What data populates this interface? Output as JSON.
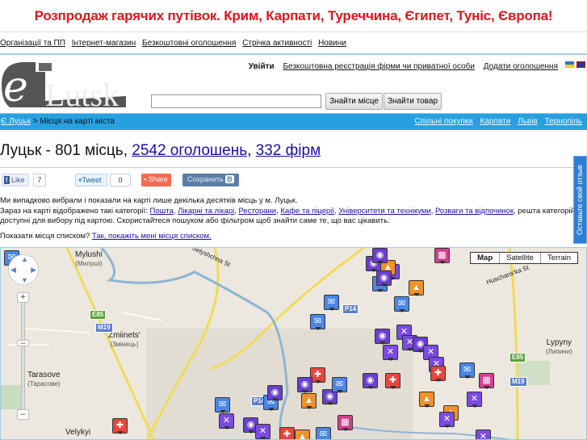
{
  "banner": "Розпродаж гарячих путівок. Крим, Карпати, Туреччина, Єгипет, Туніс, Європа!",
  "topnav": [
    "Організації та ПП",
    "Інтернет-магазин",
    "Безкоштовні оголошення",
    "Стрічка активності",
    "Новини"
  ],
  "logo": "eLutsk",
  "userlinks": {
    "login": "Увійти",
    "register": "Безкоштовна реєстрація фірми чи приватної особи",
    "add": "Додати оголошення"
  },
  "search": {
    "value": "",
    "find_place": "Знайти місце",
    "find_product": "Знайти товар"
  },
  "breadcrumb": {
    "home": "Є Луцьк",
    "sep": " > ",
    "current": "Місця на карті міста"
  },
  "cities": [
    "Спільні покупки",
    "Карпати",
    "Львів",
    "Тернопіль"
  ],
  "title": {
    "prefix": "Луцьк - 801 місць, ",
    "ads": "2542 оголошень",
    "comma": ", ",
    "firms": "332 фірм"
  },
  "social": {
    "like": "Like",
    "like_count": "7",
    "tweet": "Tweet",
    "tweet_count": "0",
    "share": "Share",
    "save": "Сохранить",
    "vk": "B"
  },
  "intro": {
    "line1": "Ми випадково вибрали і показали на карті лише декілька десятків місць у м. Луцьк.",
    "line2_prefix": "Зараз на карті відображено такі категорії: ",
    "categories": [
      "Пошта",
      "Лікарні та лікарі",
      "Ресторани",
      "Кафе та піцерії",
      "Університети та технікуми",
      "Розваги та відпочинок"
    ],
    "line2_suffix": ", решта категорій доступні",
    "line3": "для вибору під картою. Скористайтеся пошуком або фільтром щоб знайти саме те, що вас цікавить."
  },
  "showlist": {
    "question": "Показати місця списком? ",
    "link": "Так, покажіть мені місця списком."
  },
  "feedback": "Оставьте свой отзыв",
  "map": {
    "types": [
      "Map",
      "Satellite",
      "Terrain"
    ],
    "places": [
      {
        "name": "Mylushi",
        "local": "(Милуші)"
      },
      {
        "name": "Zmiinets'",
        "local": "(Змінець)"
      },
      {
        "name": "Tarasove",
        "local": "(Тарасове)"
      },
      {
        "name": "Lypyny",
        "local": "(Липини)"
      },
      {
        "name": "Velykyi",
        "local": ""
      }
    ],
    "roads": [
      "E85",
      "M19",
      "P14",
      "E85",
      "M19",
      "P14"
    ],
    "streets": [
      "Selyshchna St",
      "Huschans'ka St"
    ],
    "colors": {
      "post": "#4a86e8",
      "hospital": "#e8453c",
      "restaurant": "#7b4ae2",
      "cafe": "#6a3fd0",
      "university": "#f0912a",
      "entertainment": "#d23f8f"
    }
  }
}
